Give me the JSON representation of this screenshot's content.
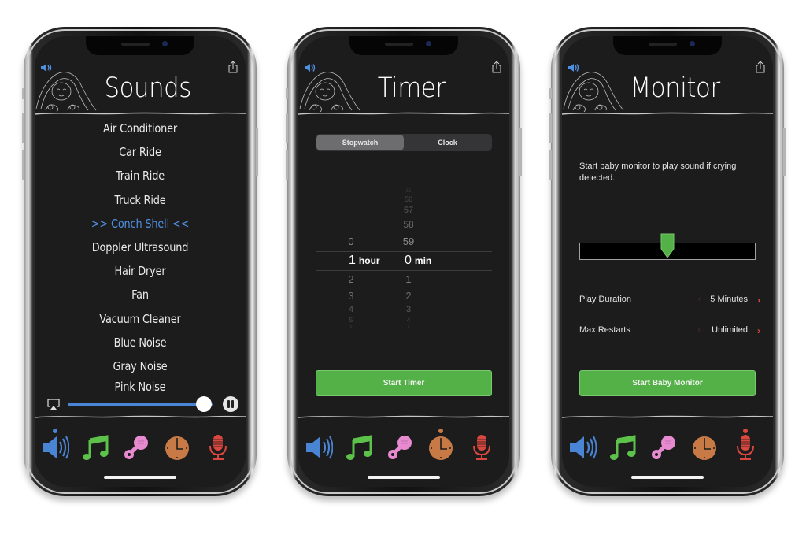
{
  "colors": {
    "screen_bg": "#1c1c1d",
    "accent_blue": "#4f8fe0",
    "button_green": "#54b147",
    "chevron_red": "#e0473b",
    "tab_sounds": "#4a84d4",
    "tab_music": "#5cc24a",
    "tab_rattle": "#e78ad0",
    "tab_timer": "#c77a45",
    "tab_monitor": "#d9473e"
  },
  "icons": {
    "volume": "speaker-icon",
    "moon": "moon-icon",
    "share": "share-icon",
    "airplay": "airplay-icon",
    "pause": "pause-icon",
    "tabs": [
      "speaker-icon",
      "music-note-icon",
      "rattle-icon",
      "clock-icon",
      "microphone-icon"
    ]
  },
  "sounds_screen": {
    "title": "Sounds",
    "items": [
      "Air Conditioner",
      "Car Ride",
      "Train Ride",
      "Truck Ride",
      ">> Conch Shell <<",
      "Doppler Ultrasound",
      "Hair Dryer",
      "Fan",
      "Vacuum Cleaner",
      "Blue Noise",
      "Gray Noise",
      "Pink Noise"
    ],
    "selected_index": 4,
    "volume_level": 0.94,
    "active_tab": 0
  },
  "timer_screen": {
    "title": "Timer",
    "segments": [
      "Stopwatch",
      "Clock"
    ],
    "selected_segment": 0,
    "hours_above": [
      "0"
    ],
    "hours_selected": "1",
    "hours_unit": "hour",
    "hours_below": [
      "2",
      "3",
      "4",
      "5",
      "6"
    ],
    "minutes_above": [
      "55",
      "56",
      "57",
      "58",
      "59"
    ],
    "minutes_selected": "0",
    "minutes_unit": "min",
    "minutes_below": [
      "1",
      "2",
      "3",
      "4",
      "5"
    ],
    "start_button": "Start Timer",
    "active_tab": 3
  },
  "monitor_screen": {
    "title": "Monitor",
    "description": "Start baby monitor to play sound if crying detected.",
    "sensitivity_level": 0.5,
    "rows": [
      {
        "label": "Play Duration",
        "value": "5 Minutes"
      },
      {
        "label": "Max Restarts",
        "value": "Unlimited"
      }
    ],
    "prev_chevron": "‹",
    "next_chevron": "›",
    "start_button": "Start Baby Monitor",
    "active_tab": 4
  }
}
